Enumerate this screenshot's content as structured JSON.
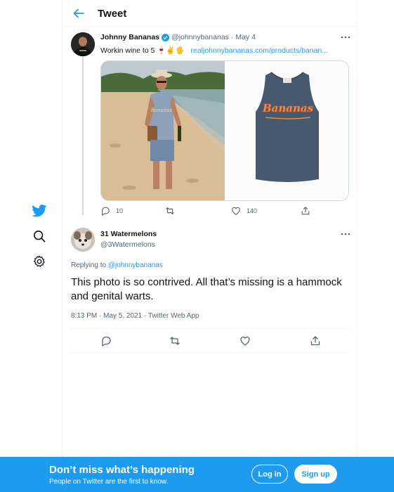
{
  "header": {
    "title": "Tweet"
  },
  "colors": {
    "accent": "#1d9bf0",
    "text": "#0f1419",
    "muted": "#536471",
    "border": "#eff3f4"
  },
  "original_tweet": {
    "name": "Johnny Bananas",
    "handle": "@johnnybananas",
    "date": "· May 4",
    "text": "Workin wine to 5 🍷✌️🖐",
    "link": "realjohnnybananas.com/products/banan...",
    "media": {
      "shirt_print": "Bananas"
    },
    "stats": {
      "replies": "10",
      "retweets": "",
      "likes": "140"
    }
  },
  "reply_tweet": {
    "name": "31 Watermelons",
    "handle": "@3Watermelons",
    "replying_label": "Replying to",
    "replying_to": "@johnnybananas",
    "text": "This photo is so contrived. All that’s missing is a hammock and genital warts.",
    "timestamp": "8:13 PM · May 5, 2021 · Twitter Web App"
  },
  "nav": {
    "items": [
      "twitter-logo",
      "search-icon",
      "settings-icon"
    ]
  },
  "bottom_bar": {
    "title": "Don’t miss what’s happening",
    "subtitle": "People on Twitter are the first to know.",
    "login_label": "Log in",
    "signup_label": "Sign up"
  }
}
